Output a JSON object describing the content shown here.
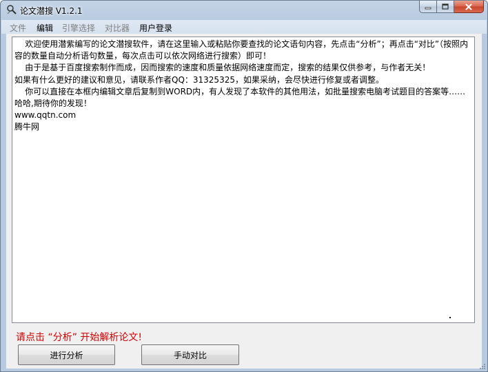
{
  "window": {
    "title": "论文潜搜 V1.2.1"
  },
  "menu": [
    {
      "label": "文件",
      "enabled": false
    },
    {
      "label": "编辑",
      "enabled": true
    },
    {
      "label": "引擎选择",
      "enabled": false
    },
    {
      "label": "对比器",
      "enabled": false
    },
    {
      "label": "用户登录",
      "enabled": true
    }
  ],
  "editor": {
    "content": "    欢迎使用潜紫编写的论文潜搜软件，请在这里输入或粘贴你要查找的论文语句内容，先点击“分析”；再点击“对比”（按照内容的数量自动分析语句数量，每次点击可以依次网络进行搜索）即可！\n    由于是基于百度搜索制作而成，因而搜索的速度和质量依据网络速度而定，搜索的结果仅供参考，与作者无关！\n如果有什么更好的建议和意见，请联系作者QQ：31325325，如果采纳，会尽快进行修复或者调整。\n    你可以直接在本框内编辑文章后复制到WORD内，有人发现了本软件的其他用法，如批量搜索电脑考试题目的答案等……哈哈,期待你的发现！\nwww.qqtn.com\n腾牛网"
  },
  "status": {
    "prompt": "请点击 “分析” 开始解析论文!"
  },
  "buttons": {
    "analyze": "进行分析",
    "compare": "手动对比"
  }
}
